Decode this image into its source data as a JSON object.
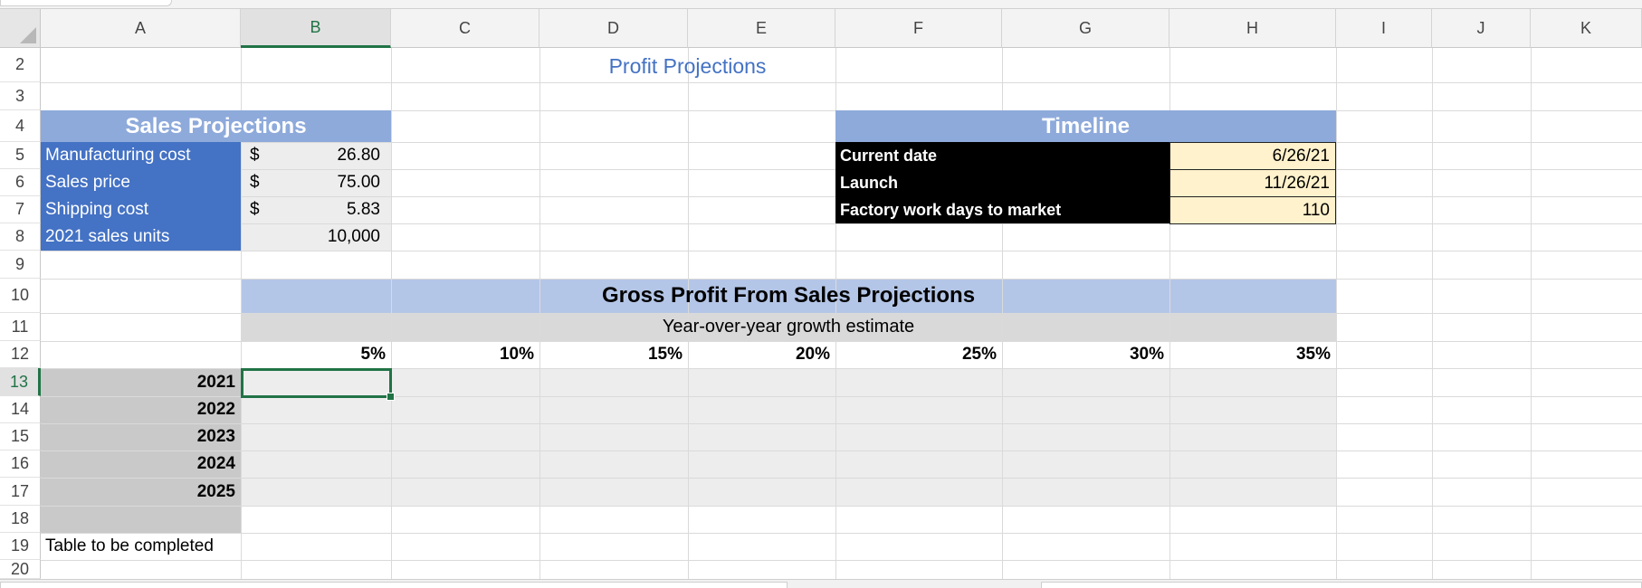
{
  "columns": [
    "A",
    "B",
    "C",
    "D",
    "E",
    "F",
    "G",
    "H",
    "I",
    "J",
    "K"
  ],
  "selected_column": "B",
  "rows": [
    "2",
    "3",
    "4",
    "5",
    "6",
    "7",
    "8",
    "9",
    "10",
    "11",
    "12",
    "13",
    "14",
    "15",
    "16",
    "17",
    "18",
    "19",
    "20"
  ],
  "selected_row": "13",
  "sheet": {
    "title": "Profit Projections",
    "sales_projections": {
      "header": "Sales Projections",
      "items": [
        {
          "label": "Manufacturing cost",
          "currency": "$",
          "value": "26.80"
        },
        {
          "label": "Sales price",
          "currency": "$",
          "value": "75.00"
        },
        {
          "label": "Shipping cost",
          "currency": "$",
          "value": "5.83"
        },
        {
          "label": "2021 sales units",
          "currency": "",
          "value": "10,000"
        }
      ]
    },
    "timeline": {
      "header": "Timeline",
      "items": [
        {
          "label": "Current date",
          "value": "6/26/21"
        },
        {
          "label": "Launch",
          "value": "11/26/21"
        },
        {
          "label": "Factory work days to market",
          "value": "110"
        }
      ]
    },
    "gross_profit": {
      "header": "Gross Profit From Sales Projections",
      "subheader": "Year-over-year growth estimate",
      "growth_rates": [
        "5%",
        "10%",
        "15%",
        "20%",
        "25%",
        "30%",
        "35%"
      ],
      "years": [
        "2021",
        "2022",
        "2023",
        "2024",
        "2025"
      ]
    },
    "note": "Table to be completed"
  },
  "colors": {
    "header_band": "#8eaadb",
    "label_blue": "#4472c4",
    "cream": "#fff2cc",
    "selection_green": "#217346",
    "light_gray": "#ededed",
    "year_gray": "#c9c9c9"
  }
}
